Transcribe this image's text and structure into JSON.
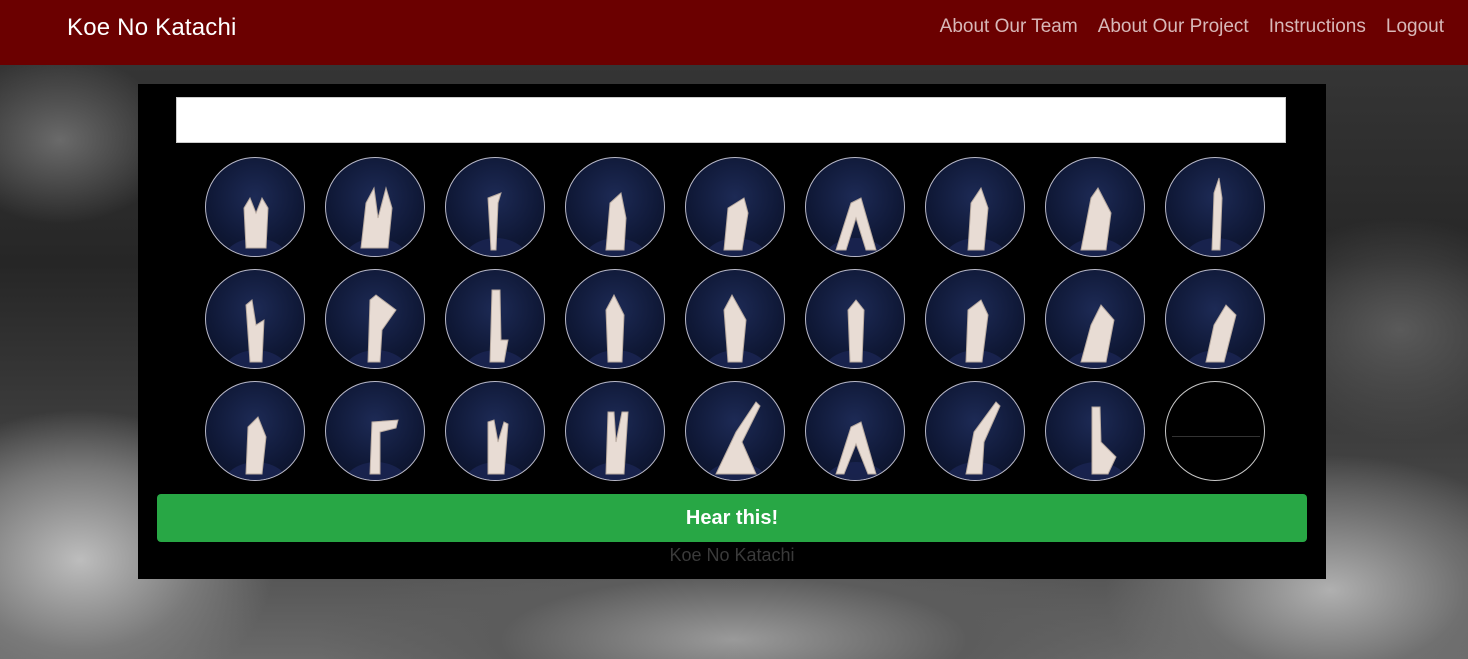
{
  "app": {
    "brand": "Koe No Katachi"
  },
  "nav": {
    "items": [
      {
        "label": "About Our Team"
      },
      {
        "label": "About Our Project"
      },
      {
        "label": "Instructions"
      },
      {
        "label": "Logout"
      }
    ]
  },
  "main": {
    "text_output_value": "",
    "signs": [
      {
        "icon": "hand-sign-icon"
      },
      {
        "icon": "hand-sign-icon"
      },
      {
        "icon": "hand-sign-icon"
      },
      {
        "icon": "hand-sign-icon"
      },
      {
        "icon": "hand-sign-icon"
      },
      {
        "icon": "hand-sign-icon"
      },
      {
        "icon": "hand-sign-icon"
      },
      {
        "icon": "hand-sign-icon"
      },
      {
        "icon": "hand-sign-icon"
      },
      {
        "icon": "hand-sign-icon"
      },
      {
        "icon": "hand-sign-icon"
      },
      {
        "icon": "hand-sign-icon"
      },
      {
        "icon": "hand-sign-icon"
      },
      {
        "icon": "hand-sign-icon"
      },
      {
        "icon": "hand-sign-icon"
      },
      {
        "icon": "hand-sign-icon"
      },
      {
        "icon": "hand-sign-icon"
      },
      {
        "icon": "hand-sign-icon"
      },
      {
        "icon": "hand-sign-icon"
      },
      {
        "icon": "hand-sign-icon"
      },
      {
        "icon": "hand-sign-icon"
      },
      {
        "icon": "hand-sign-icon"
      },
      {
        "icon": "hand-sign-icon"
      },
      {
        "icon": "hand-sign-icon"
      },
      {
        "icon": "hand-sign-icon"
      },
      {
        "icon": "hand-sign-icon"
      },
      {
        "icon": "blank-sign-icon"
      }
    ],
    "hear_button_label": "Hear this!",
    "footer_text": "Koe No Katachi"
  },
  "colors": {
    "navbar": "#6b0000",
    "button": "#28a745",
    "panel": "#000000"
  }
}
